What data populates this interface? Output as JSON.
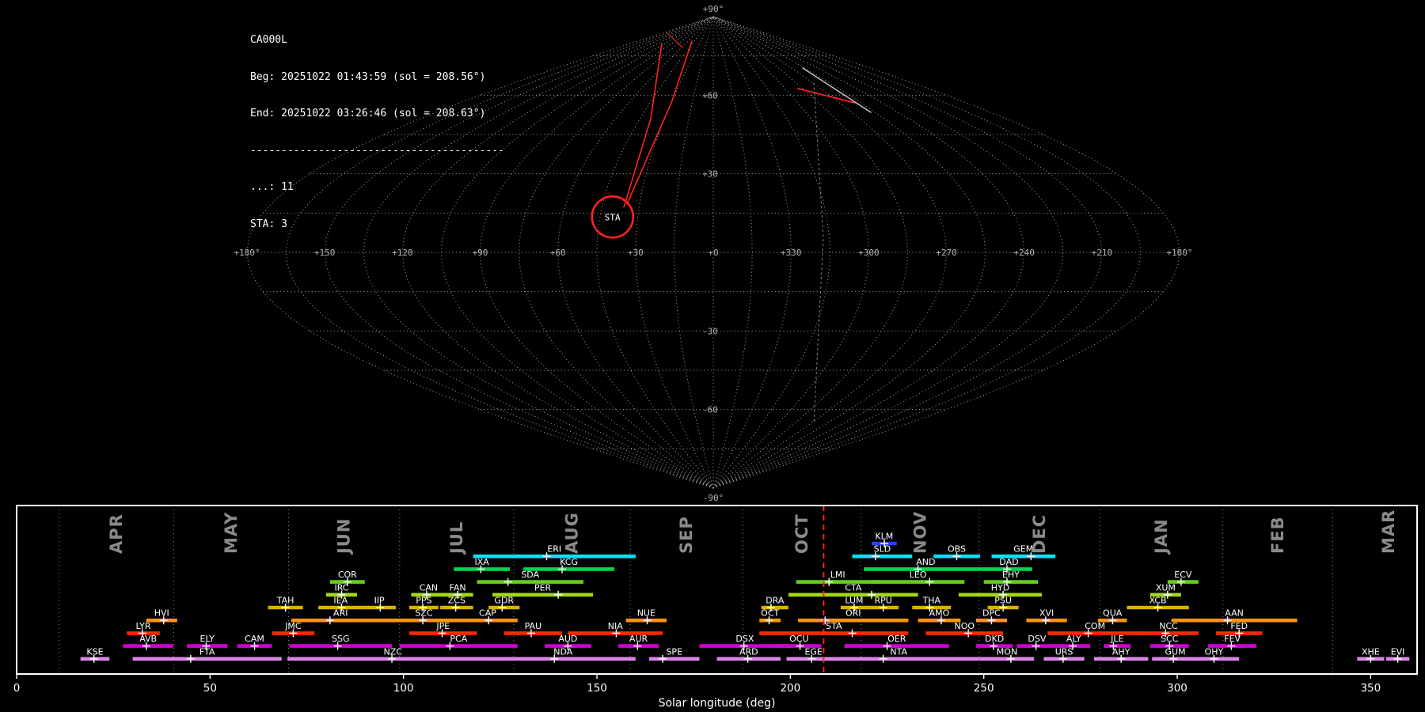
{
  "header": {
    "station": "CA000L",
    "beg_line": "Beg: 20251022 01:43:59 (sol = 208.56°)",
    "end_line": "End: 20251022 03:26:46 (sol = 208.63°)",
    "separator": "-----------------------------------------",
    "unknown_count_line": "...: 11",
    "sta_count_line": "STA: 3"
  },
  "skymap": {
    "grid_color": "#b0b0b0",
    "lat_labels": [
      {
        "text": "+90°",
        "lat": 90
      },
      {
        "text": "+60",
        "lat": 60
      },
      {
        "text": "+30",
        "lat": 30
      },
      {
        "text": "-30",
        "lat": -30
      },
      {
        "text": "-60",
        "lat": -60
      },
      {
        "text": "-90°",
        "lat": -90
      }
    ],
    "lon_labels": [
      {
        "text": "+180°",
        "lon": 180
      },
      {
        "text": "+150",
        "lon": 150
      },
      {
        "text": "+120",
        "lon": 120
      },
      {
        "text": "+90",
        "lon": 90
      },
      {
        "text": "+60",
        "lon": 60
      },
      {
        "text": "+30",
        "lon": 30
      },
      {
        "text": "+0",
        "lon": 0
      },
      {
        "text": "+330",
        "lon": -30
      },
      {
        "text": "+300",
        "lon": -60
      },
      {
        "text": "+270",
        "lon": -90
      },
      {
        "text": "+240",
        "lon": -120
      },
      {
        "text": "+210",
        "lon": -150
      },
      {
        "text": "+180°",
        "lon": -180
      }
    ],
    "radiant": {
      "label": "STA",
      "lon": 40,
      "lat": 13.5,
      "color": "#ff2222"
    },
    "trails": [
      {
        "name": "meteor-trail",
        "color": "#ff2222",
        "width": 1.6,
        "points": [
          [
            788,
            262
          ],
          [
            822,
            150
          ],
          [
            836,
            55
          ]
        ]
      },
      {
        "name": "meteor-trail",
        "color": "#ff2222",
        "width": 1.6,
        "points": [
          [
            792,
            258
          ],
          [
            848,
            130
          ],
          [
            874,
            52
          ]
        ]
      },
      {
        "name": "meteor-trail",
        "color": "#ff2222",
        "width": 1.8,
        "points": [
          [
            1008,
            112
          ],
          [
            1080,
            130
          ]
        ]
      },
      {
        "name": "meteor-trail",
        "color": "#cfcfcf",
        "width": 1.4,
        "points": [
          [
            1014,
            86
          ],
          [
            1100,
            142
          ]
        ]
      },
      {
        "name": "meteor-trail",
        "color": "#ff2222",
        "width": 1.2,
        "points": [
          [
            843,
            42
          ],
          [
            862,
            60
          ]
        ]
      },
      {
        "name": "track-curve",
        "color": "#888888",
        "width": 1,
        "dash": "2 4",
        "points": [
          [
            1028,
            105
          ],
          [
            1040,
            300
          ],
          [
            1028,
            535
          ]
        ]
      }
    ]
  },
  "chart_data": {
    "type": "gantt",
    "title": "Meteor shower activity periods",
    "xlabel": "Solar longitude (deg)",
    "xlim": [
      0,
      362
    ],
    "xticks": [
      0,
      50,
      100,
      150,
      200,
      250,
      300,
      350
    ],
    "grid": "month-boundaries-dotted",
    "current_sol": 208.6,
    "current_sol_color": "#ff2222",
    "months": [
      {
        "label": "APR",
        "start": 11.0,
        "end": 40.6
      },
      {
        "label": "MAY",
        "start": 40.6,
        "end": 70.3
      },
      {
        "label": "JUN",
        "start": 70.3,
        "end": 99.0
      },
      {
        "label": "JUL",
        "start": 99.0,
        "end": 128.5
      },
      {
        "label": "AUG",
        "start": 128.5,
        "end": 158.6
      },
      {
        "label": "SEP",
        "start": 158.6,
        "end": 187.7
      },
      {
        "label": "OCT",
        "start": 187.7,
        "end": 218.3
      },
      {
        "label": "NOV",
        "start": 218.3,
        "end": 248.8
      },
      {
        "label": "DEC",
        "start": 248.8,
        "end": 280.0
      },
      {
        "label": "JAN",
        "start": 280.0,
        "end": 311.8
      },
      {
        "label": "FEB",
        "start": 311.8,
        "end": 340.2
      },
      {
        "label": "MAR",
        "start": 340.2,
        "end": 369.0
      }
    ],
    "rows": [
      {
        "color": "#2b3fff",
        "showers": [
          {
            "code": "KLM",
            "start": 221,
            "end": 227.5,
            "peak": 224.3
          }
        ]
      },
      {
        "color": "#00e5ff",
        "showers": [
          {
            "code": "ERI",
            "start": 118,
            "end": 160,
            "peak": 137
          },
          {
            "code": "SLD",
            "start": 216,
            "end": 231.5,
            "peak": 222
          },
          {
            "code": "OBS",
            "start": 237,
            "end": 249,
            "peak": 243
          },
          {
            "code": "GEM",
            "start": 252,
            "end": 268.5,
            "peak": 262.2
          }
        ]
      },
      {
        "color": "#00d44f",
        "showers": [
          {
            "code": "IXA",
            "start": 113,
            "end": 127.5,
            "peak": 120
          },
          {
            "code": "KCG",
            "start": 131,
            "end": 154.5,
            "peak": 141
          },
          {
            "code": "AND",
            "start": 219,
            "end": 251,
            "peak": 233
          },
          {
            "code": "DAD",
            "start": 250.5,
            "end": 262.5,
            "peak": 256
          }
        ]
      },
      {
        "color": "#63cf1d",
        "showers": [
          {
            "code": "COR",
            "start": 81,
            "end": 90,
            "peak": 85.5
          },
          {
            "code": "SDA",
            "start": 119,
            "end": 146.5,
            "peak": 127
          },
          {
            "code": "LMI",
            "start": 201.5,
            "end": 223,
            "peak": 210
          },
          {
            "code": "LEO",
            "start": 221,
            "end": 245,
            "peak": 236
          },
          {
            "code": "EHY",
            "start": 250,
            "end": 264,
            "peak": 256
          },
          {
            "code": "ECV",
            "start": 297.5,
            "end": 305.5,
            "peak": 301
          }
        ]
      },
      {
        "color": "#a4d813",
        "showers": [
          {
            "code": "IRC",
            "start": 80,
            "end": 88,
            "peak": 84
          },
          {
            "code": "CAN",
            "start": 102,
            "end": 111,
            "peak": 106
          },
          {
            "code": "FAN",
            "start": 110,
            "end": 118,
            "peak": 114
          },
          {
            "code": "PER",
            "start": 123,
            "end": 149,
            "peak": 140
          },
          {
            "code": "CTA",
            "start": 199.5,
            "end": 233,
            "peak": 221
          },
          {
            "code": "HYD",
            "start": 243.5,
            "end": 265,
            "peak": 255
          },
          {
            "code": "XUM",
            "start": 293,
            "end": 301,
            "peak": 297.5
          }
        ]
      },
      {
        "color": "#d7b200",
        "showers": [
          {
            "code": "TAH",
            "start": 65,
            "end": 74,
            "peak": 69.5
          },
          {
            "code": "IEA",
            "start": 78,
            "end": 89.5,
            "peak": 84
          },
          {
            "code": "IIP",
            "start": 89.5,
            "end": 98,
            "peak": 94
          },
          {
            "code": "PPS",
            "start": 101.5,
            "end": 109,
            "peak": 105
          },
          {
            "code": "ZCS",
            "start": 109.5,
            "end": 118,
            "peak": 113.5
          },
          {
            "code": "GDR",
            "start": 122,
            "end": 130,
            "peak": 125.5
          },
          {
            "code": "DRA",
            "start": 192.5,
            "end": 199.5,
            "peak": 195
          },
          {
            "code": "LUM",
            "start": 213,
            "end": 220,
            "peak": 216.5
          },
          {
            "code": "RPU",
            "start": 220,
            "end": 228,
            "peak": 224
          },
          {
            "code": "THA",
            "start": 231.5,
            "end": 241.5,
            "peak": 236
          },
          {
            "code": "PSU",
            "start": 251,
            "end": 259,
            "peak": 255
          },
          {
            "code": "XCB",
            "start": 287,
            "end": 303,
            "peak": 295
          }
        ]
      },
      {
        "color": "#ff9500",
        "showers": [
          {
            "code": "HVI",
            "start": 33.5,
            "end": 41.5,
            "peak": 38
          },
          {
            "code": "ARI",
            "start": 71,
            "end": 96.5,
            "peak": 81
          },
          {
            "code": "SZC",
            "start": 96.5,
            "end": 114,
            "peak": 105
          },
          {
            "code": "CAP",
            "start": 114,
            "end": 129.5,
            "peak": 122
          },
          {
            "code": "NUE",
            "start": 157.5,
            "end": 168,
            "peak": 163
          },
          {
            "code": "OCT",
            "start": 192,
            "end": 197.5,
            "peak": 194.5
          },
          {
            "code": "ORI",
            "start": 202,
            "end": 230.5,
            "peak": 209
          },
          {
            "code": "AMO",
            "start": 233,
            "end": 244,
            "peak": 239
          },
          {
            "code": "DPC",
            "start": 248,
            "end": 256,
            "peak": 252
          },
          {
            "code": "XVI",
            "start": 261,
            "end": 271.5,
            "peak": 266
          },
          {
            "code": "QUA",
            "start": 279.5,
            "end": 287,
            "peak": 283.3
          },
          {
            "code": "AAN",
            "start": 298.5,
            "end": 331,
            "peak": 313
          }
        ]
      },
      {
        "color": "#ff2800",
        "showers": [
          {
            "code": "LYR",
            "start": 28.5,
            "end": 37,
            "peak": 32.5
          },
          {
            "code": "JMC",
            "start": 66,
            "end": 77,
            "peak": 71.5
          },
          {
            "code": "JPE",
            "start": 101.5,
            "end": 119,
            "peak": 110
          },
          {
            "code": "PAU",
            "start": 126,
            "end": 141,
            "peak": 133
          },
          {
            "code": "NIA",
            "start": 142.5,
            "end": 167,
            "peak": 155
          },
          {
            "code": "STA",
            "start": 192,
            "end": 230.5,
            "peak": 216
          },
          {
            "code": "NOO",
            "start": 235,
            "end": 255,
            "peak": 246
          },
          {
            "code": "COM",
            "start": 266.5,
            "end": 291,
            "peak": 277
          },
          {
            "code": "NCC",
            "start": 290,
            "end": 305.5,
            "peak": 297
          },
          {
            "code": "FED",
            "start": 310,
            "end": 322,
            "peak": 316
          }
        ]
      },
      {
        "color": "#cf00cf",
        "showers": [
          {
            "code": "AVB",
            "start": 27.5,
            "end": 40.5,
            "peak": 33.5
          },
          {
            "code": "ELY",
            "start": 44,
            "end": 54.5,
            "peak": 49
          },
          {
            "code": "CAM",
            "start": 57,
            "end": 66,
            "peak": 61.5
          },
          {
            "code": "SSG",
            "start": 70.5,
            "end": 97,
            "peak": 83
          },
          {
            "code": "PCA",
            "start": 99,
            "end": 129.5,
            "peak": 112
          },
          {
            "code": "AUD",
            "start": 136.5,
            "end": 148.5,
            "peak": 142.5
          },
          {
            "code": "AUR",
            "start": 155.5,
            "end": 166,
            "peak": 160.5
          },
          {
            "code": "DSX",
            "start": 176.5,
            "end": 200,
            "peak": 188
          },
          {
            "code": "OCU",
            "start": 196.5,
            "end": 208,
            "peak": 202.5
          },
          {
            "code": "OER",
            "start": 214,
            "end": 241,
            "peak": 225
          },
          {
            "code": "DKD",
            "start": 248,
            "end": 257.5,
            "peak": 252.5
          },
          {
            "code": "DSV",
            "start": 258.5,
            "end": 269,
            "peak": 263.5
          },
          {
            "code": "ALY",
            "start": 269,
            "end": 277.5,
            "peak": 273
          },
          {
            "code": "JLE",
            "start": 281,
            "end": 288,
            "peak": 283.5
          },
          {
            "code": "SCC",
            "start": 293,
            "end": 303,
            "peak": 298
          },
          {
            "code": "FEV",
            "start": 308,
            "end": 320.5,
            "peak": 314
          }
        ]
      },
      {
        "color": "#da85e8",
        "showers": [
          {
            "code": "KSE",
            "start": 16.5,
            "end": 24,
            "peak": 20
          },
          {
            "code": "FTA",
            "start": 30,
            "end": 68.5,
            "peak": 45
          },
          {
            "code": "NZC",
            "start": 70,
            "end": 124.5,
            "peak": 97
          },
          {
            "code": "NDA",
            "start": 122.5,
            "end": 160,
            "peak": 139
          },
          {
            "code": "SPE",
            "start": 163.5,
            "end": 176.5,
            "peak": 167
          },
          {
            "code": "ARD",
            "start": 181,
            "end": 197.5,
            "peak": 189
          },
          {
            "code": "EGE",
            "start": 199,
            "end": 213,
            "peak": 205.5
          },
          {
            "code": "NTA",
            "start": 207,
            "end": 249,
            "peak": 224
          },
          {
            "code": "MON",
            "start": 249,
            "end": 263,
            "peak": 257
          },
          {
            "code": "URS",
            "start": 265.5,
            "end": 276,
            "peak": 270.5
          },
          {
            "code": "AHY",
            "start": 278.5,
            "end": 292.5,
            "peak": 285.5
          },
          {
            "code": "GUM",
            "start": 293.5,
            "end": 305.5,
            "peak": 299
          },
          {
            "code": "OHY",
            "start": 303,
            "end": 316,
            "peak": 309.5
          },
          {
            "code": "XHE",
            "start": 346.5,
            "end": 353.5,
            "peak": 350
          },
          {
            "code": "EVI",
            "start": 354,
            "end": 360,
            "peak": 357
          }
        ]
      }
    ]
  }
}
